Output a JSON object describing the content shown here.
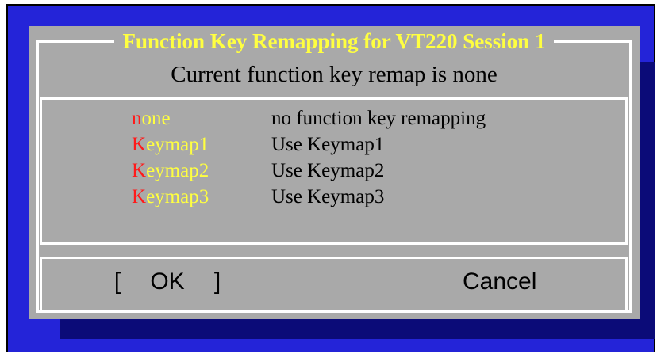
{
  "dialog": {
    "title": "Function Key Remapping for VT220 Session 1",
    "status": "Current function key remap is none",
    "options": [
      {
        "hotkey": "n",
        "rest": "one",
        "description": "no function key remapping"
      },
      {
        "hotkey": "K",
        "rest": "eymap1",
        "description": "Use Keymap1"
      },
      {
        "hotkey": "K",
        "rest": "eymap2",
        "description": "Use Keymap2"
      },
      {
        "hotkey": "K",
        "rest": "eymap3",
        "description": "Use Keymap3"
      }
    ],
    "buttons": {
      "ok_open": "[",
      "ok_label": "OK",
      "ok_close": "]",
      "cancel_label": "Cancel"
    }
  },
  "colors": {
    "screen_bg": "#2424d8",
    "shadow": "#0b0b78",
    "dialog_bg": "#a9a9a9",
    "title": "#ffff40",
    "hotkey": "#ff1a1a",
    "border": "#ffffff"
  }
}
